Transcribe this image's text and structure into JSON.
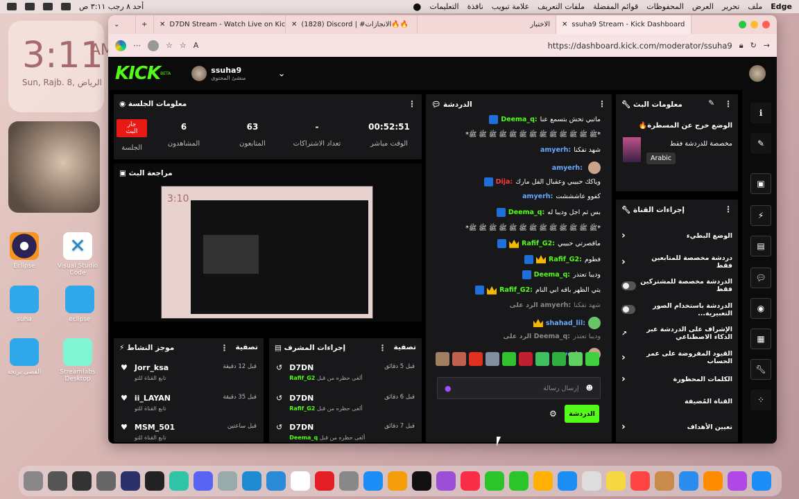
{
  "menubar": {
    "app": "Edge",
    "menus": [
      "ملف",
      "تحرير",
      "العرض",
      "المحفوظات",
      "قوائم المفضلة",
      "ملفات التعريف",
      "علامة تبويب",
      "نافذة",
      "التعليمات"
    ],
    "clock": "أحد ٨ رجب ٣:١١ ص"
  },
  "desktop": {
    "widget_time": "3:11",
    "widget_ampm": "AM",
    "widget_date": "Sun, Rajb. 8, الرياض",
    "icons": [
      "Eclipse",
      "Visual Studio Code",
      "suha",
      "eclipse",
      "القضى يرنجة",
      "Streamlabs Desktop"
    ]
  },
  "browser": {
    "tabs": [
      "ssuha9 Stream - Kick Dashboard",
      "الاختبار",
      "(1828) Discord | #الانجازات🔥🔥",
      "D7DN Stream - Watch Live on Kick"
    ],
    "url": "https://dashboard.kick.com/moderator/ssuha9",
    "ai_label": "A"
  },
  "kick": {
    "logo": "KICK",
    "beta": "BETA",
    "username": "ssuha9",
    "role": "منشئ المحتوى"
  },
  "session": {
    "title": "معلومات الجلسة",
    "live_badge": "جار البث",
    "session_label": "الجلسة",
    "stats": [
      {
        "v": "00:52:51",
        "l": "الوقت مباشر"
      },
      {
        "v": "-",
        "l": "تعداد الاشتراكات"
      },
      {
        "v": "63",
        "l": "المتابعون"
      },
      {
        "v": "6",
        "l": "المشاهدون"
      }
    ]
  },
  "preview": {
    "title": "مراجعة البث"
  },
  "activity": {
    "title": "موجز النشاط",
    "filter": "تصفية",
    "items": [
      {
        "name": "Jorr_ksa",
        "sub": "تابع القناة للتو",
        "time": "قبل 12 دقيقة"
      },
      {
        "name": "ii_LAYAN",
        "sub": "تابع القناة للتو",
        "time": "قبل 35 دقيقة"
      },
      {
        "name": "MSM_501",
        "sub": "تابع القناة للتو",
        "time": "قبل ساعتين"
      }
    ]
  },
  "modactions": {
    "title": "إجراءات المشرف",
    "filter": "تصفية",
    "items": [
      {
        "name": "D7DN",
        "sub": "ألغى حظره من قبل",
        "by": "Rafif_G2",
        "time": "قبل 5 دقائق"
      },
      {
        "name": "D7DN",
        "sub": "ألغى حظره من قبل",
        "by": "Rafif_G2",
        "time": "قبل 6 دقائق"
      },
      {
        "name": "D7DN",
        "sub": "ألغى حظره من قبل",
        "by": "Deema_q",
        "time": "قبل 7 دقائق"
      }
    ]
  },
  "chat": {
    "title": "الدردشة",
    "input_placeholder": "إرسال رسالة",
    "send": "الدردشة",
    "lines": [
      {
        "u": "Deema_q:",
        "t": "ماتبي تحش بتسمع عنا",
        "c": "#53fc18"
      },
      {
        "u": "",
        "t": "*ﷺ ﷺ ﷺ ﷺ ﷺ ﷺ ﷺ ﷺ ﷺ ﷺ ﷺ ﷺ ﷺ*",
        "c": "#fff"
      },
      {
        "u": "amyerh:",
        "t": "شهد تفكنا",
        "c": "#6aa9ff"
      },
      {
        "u": "amyerh:",
        "t": "",
        "c": "#6aa9ff"
      },
      {
        "u": "Dija:",
        "t": "وياكك حبيبي وعقبال الفل مارك",
        "c": "#ff3b3b"
      },
      {
        "u": "amyerh:",
        "t": "كفوو عاشششت",
        "c": "#6aa9ff"
      },
      {
        "u": "Deema_q:",
        "t": "بس ثم اجل وديبا له",
        "c": "#53fc18"
      },
      {
        "u": "",
        "t": "*ﷺ ﷺ ﷺ ﷺ ﷺ ﷺ ﷺ ﷺ ﷺ ﷺ ﷺ ﷺ ﷺ*",
        "c": "#fff"
      },
      {
        "u": "Rafif_G2:",
        "t": "ماقصرتي حبيبي",
        "c": "#53fc18"
      },
      {
        "u": "Rafif_G2:",
        "t": "فطوم",
        "c": "#53fc18"
      },
      {
        "u": "Deema_q:",
        "t": "وديبا تعتذر",
        "c": "#53fc18"
      },
      {
        "u": "Rafif_G2:",
        "t": "يتي الظهر باقه ابي النام",
        "c": "#53fc18"
      },
      {
        "u": "الرد على amyerh:",
        "t": "شهد تفكنا",
        "c": "#888"
      },
      {
        "u": "shahad_lil:",
        "t": "",
        "c": "#6aa9ff"
      },
      {
        "u": "الرد على Deema_q:",
        "t": "وديبا تعتذر",
        "c": "#888"
      },
      {
        "u": "amyerh:",
        "t": "",
        "c": "#6aa9ff"
      }
    ]
  },
  "streaminfo": {
    "title": "معلومات البث",
    "stream_title": "الوضع خرج عن المسطرة🔥",
    "category": "مخصصة للدردشة فقط",
    "language": "Arabic"
  },
  "channel": {
    "title": "إجراءات القناة",
    "items": [
      "الوضع البطيء",
      "دردشة مخصصة للمتابعين فقط",
      "الدردشة مخصصة للمشتركين فقط",
      "الدردشة باستخدام الصور التعبيرية...",
      "الإشراف على الدردشة عبر الذكاء الاصطناعي",
      "القيود المفروضة على عمر الحساب",
      "الكلمات المحظورة",
      "القناة المُضيفة",
      "تعيين الأهداف"
    ]
  },
  "colors": {
    "kick_green": "#53fc18",
    "live_red": "#e91916",
    "panel": "#18181b"
  }
}
